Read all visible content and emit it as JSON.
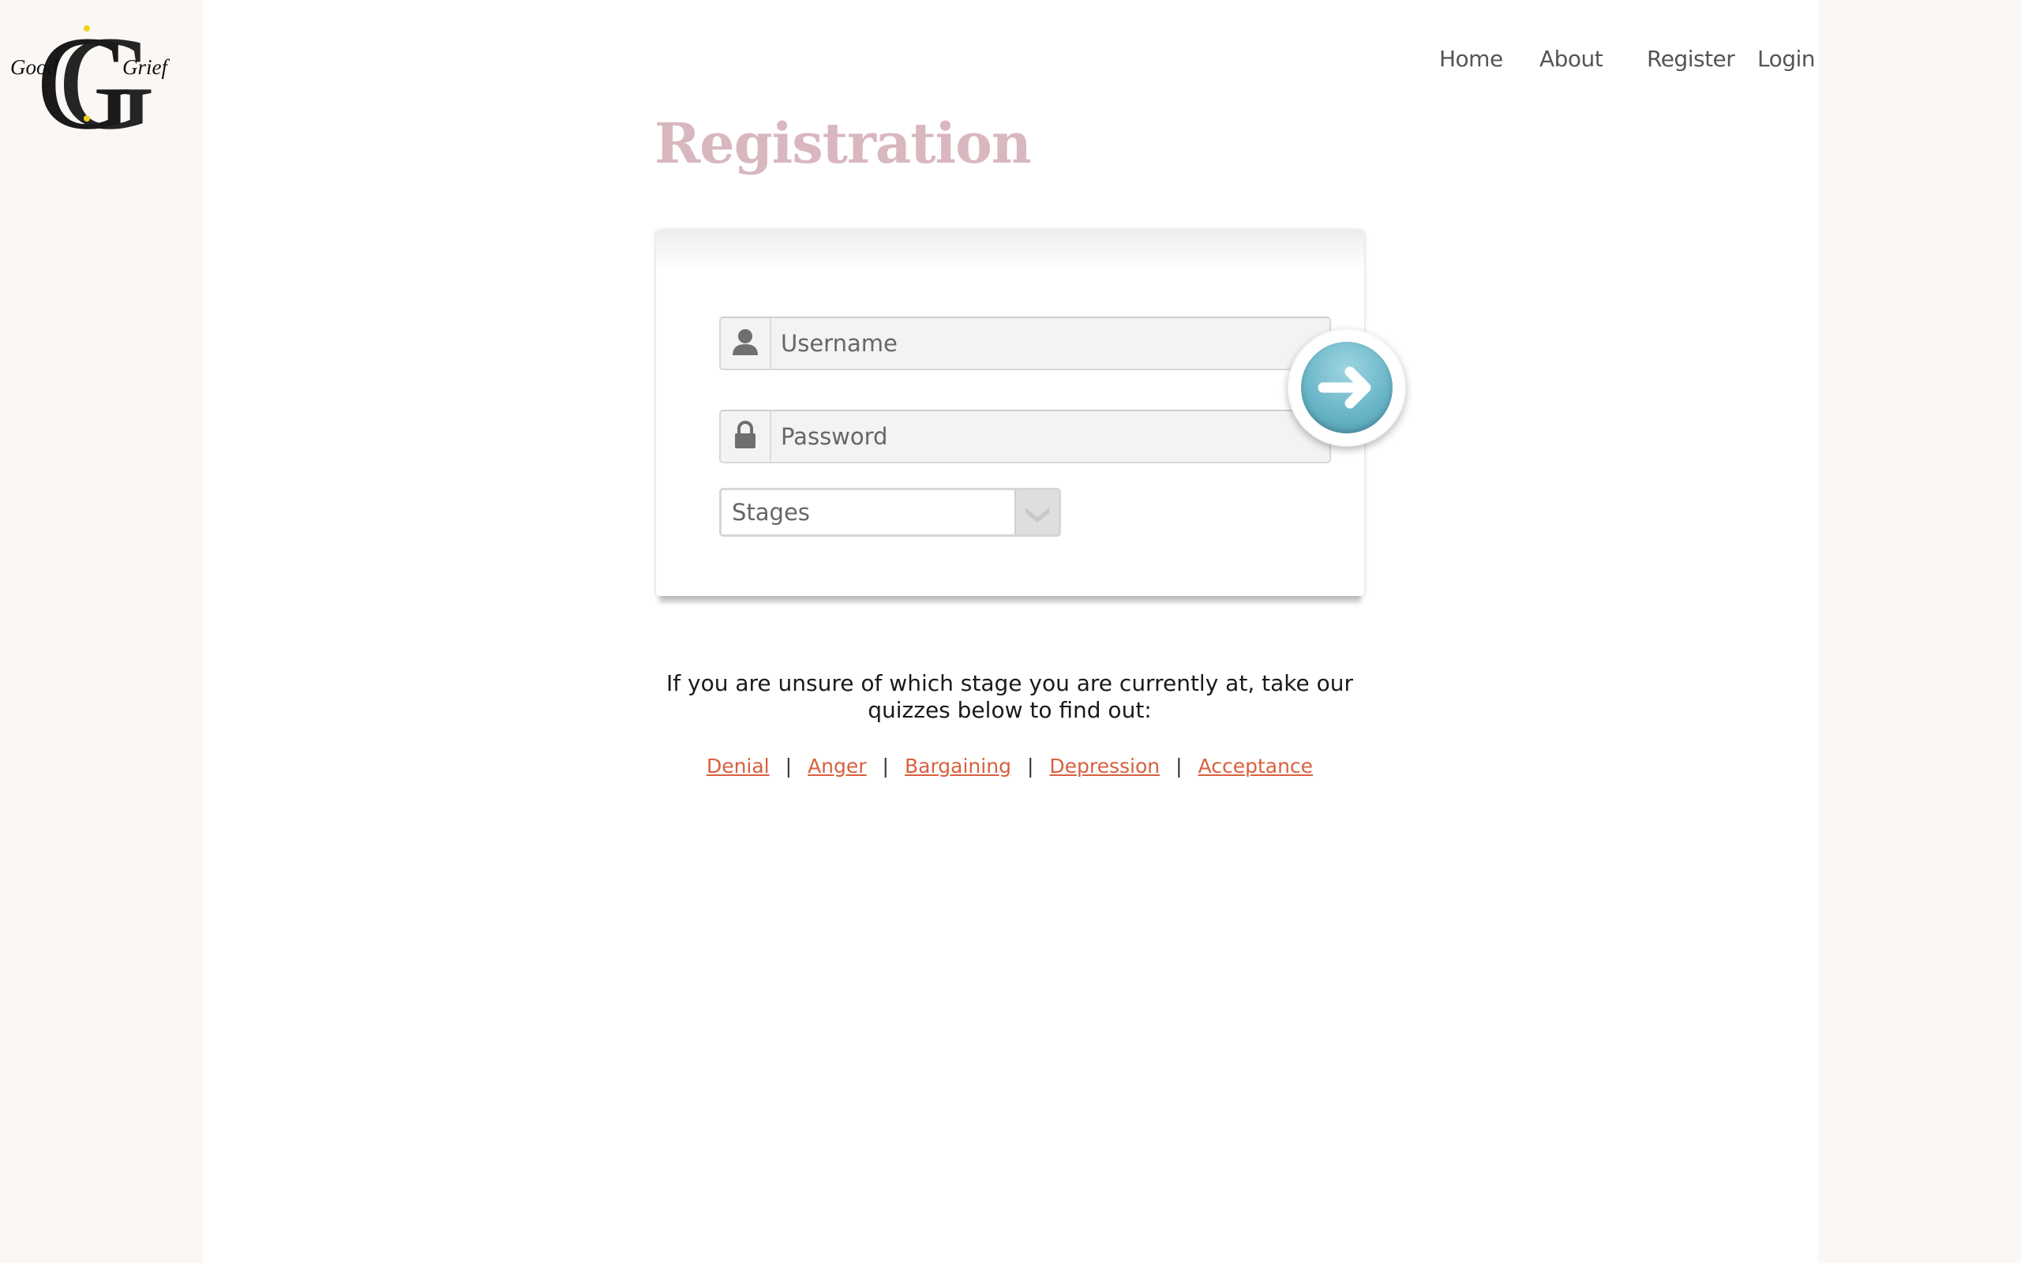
{
  "logo": {
    "left_word": "Good",
    "right_word": "Grief",
    "monogram": "GG"
  },
  "nav": {
    "items": [
      "Home",
      "About",
      "Register",
      "Login"
    ]
  },
  "page": {
    "title": "Registration"
  },
  "form": {
    "username_placeholder": "Username",
    "password_placeholder": "Password",
    "stages_selected": "Stages",
    "submit_icon": "arrow-right-icon"
  },
  "quiz_prompt": "If you are unsure of which stage you are currently at, take our quizzes below to find out:",
  "quiz_links": [
    "Denial",
    "Anger",
    "Bargaining",
    "Depression",
    "Acceptance"
  ],
  "colors": {
    "title": "#d9b7bf",
    "link": "#d9603f",
    "button": "#6bb7c9",
    "sidebar_bg": "#fbf7f4"
  }
}
